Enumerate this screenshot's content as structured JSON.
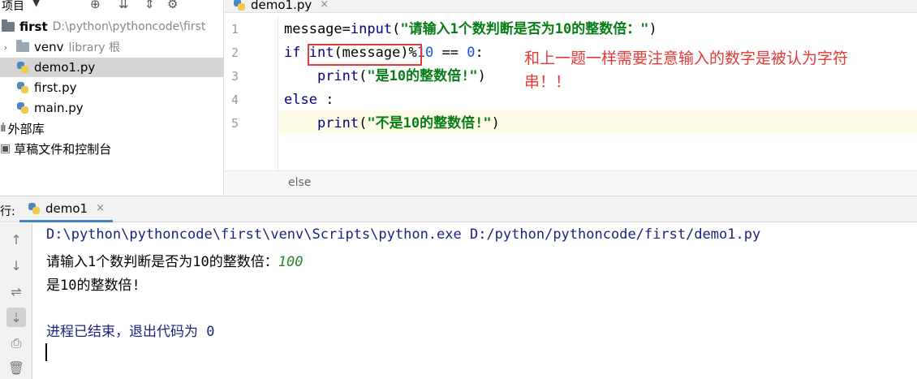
{
  "project_panel": {
    "title": "项目",
    "caret": "▼",
    "toolbar_icons": [
      "⊕",
      "⇊",
      "⇕",
      "⚙"
    ],
    "root": {
      "name": "first",
      "path": "D:\\python\\pythoncode\\first"
    },
    "items": [
      {
        "name": "venv",
        "hint": "library 根"
      },
      {
        "name": "demo1.py"
      },
      {
        "name": "first.py"
      },
      {
        "name": "main.py"
      }
    ],
    "external_libs": "外部库",
    "scratches": "草稿文件和控制台"
  },
  "editor": {
    "tab_label": "demo1.py",
    "tab_close": "×",
    "line_numbers": [
      "1",
      "2",
      "3",
      "4",
      "5"
    ],
    "lines": {
      "l1": {
        "a": "message=",
        "b": "input",
        "c": "(",
        "d": "\"请输入1个数判断是否为10的整数倍：\"",
        "e": ")"
      },
      "l2": {
        "a": "if ",
        "b": "int",
        "c": "(message)%",
        "d": "10",
        "e": " == ",
        "f": "0",
        "g": ":"
      },
      "l3": {
        "indent": "    ",
        "a": "print",
        "b": "(",
        "c": "\"是10的整数倍!\"",
        "d": ")"
      },
      "l4": {
        "a": "else",
        "b": " :"
      },
      "l5": {
        "indent": "    ",
        "a": "print",
        "b": "(",
        "c": "\"不是10的整数倍!\"",
        "d": ")"
      }
    },
    "annotation": "和上一题一样需要注意输入的数字是被认为字符串！！",
    "breadcrumb": "else"
  },
  "run_panel": {
    "label": "行:",
    "tab_label": "demo1",
    "tab_close": "×",
    "toolbar_icons": [
      "↑",
      "↓",
      "⇌",
      "⇣",
      "⎙",
      "🗑"
    ],
    "console": {
      "command": "D:\\python\\pythoncode\\first\\venv\\Scripts\\python.exe D:/python/pythoncode/first/demo1.py",
      "prompt": "请输入1个数判断是否为10的整数倍：",
      "input_value": "100",
      "output": "是10的整数倍!",
      "exit": "进程已结束，退出代码为 0"
    }
  }
}
